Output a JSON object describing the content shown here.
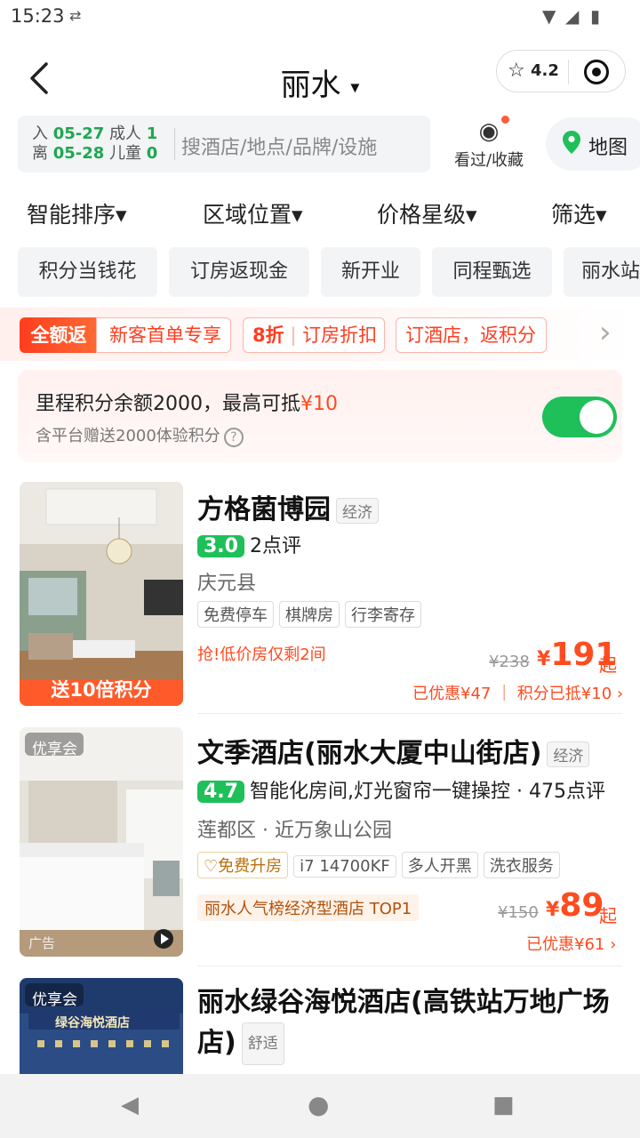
{
  "status": {
    "time": "15:23",
    "icons": "▼◢ ▮"
  },
  "header": {
    "city": "丽水",
    "city_arrow": "▾",
    "rating": "4.2"
  },
  "search": {
    "checkin_label": "入",
    "checkin_date": "05-27",
    "adult_label": "成人",
    "adults": "1",
    "checkout_label": "离",
    "checkout_date": "05-28",
    "child_label": "儿童",
    "children": "0",
    "placeholder": "搜酒店/地点/品牌/设施"
  },
  "favorites": {
    "label": "看过/收藏"
  },
  "map": {
    "label": "地图"
  },
  "sort": [
    "智能排序▾",
    "区域位置▾",
    "价格星级▾",
    "筛选▾"
  ],
  "quick_tags": [
    "积分当钱花",
    "订房返现金",
    "新开业",
    "同程甄选",
    "丽水站"
  ],
  "promo": {
    "full_label": "全额返",
    "item1": "新客首单专享",
    "discount": "8折",
    "item2": "订房折扣",
    "item3": "订酒店，返积分",
    "arrow": "›"
  },
  "points_card": {
    "line1_prefix": "里程积分余额2000，最高可抵",
    "line1_amount": "¥10",
    "line2": "含平台赠送2000体验积分",
    "help": "?"
  },
  "hotels": [
    {
      "name": "方格菌博园",
      "level": "经济",
      "score": "3.0",
      "reviews": "2点评",
      "area": "庆元县",
      "tags": [
        "免费停车",
        "棋牌房",
        "行李寄存"
      ],
      "urgent": "抢!低价房仅剩2间",
      "orig_price": "¥238",
      "price_symbol": "¥",
      "price": "191",
      "qi": "起",
      "discount": "已优惠¥47 ｜ 积分已抵¥10 ›",
      "banner": "送10倍积分"
    },
    {
      "name": "文季酒店(丽水大厦中山街店)",
      "level": "经济",
      "score": "4.7",
      "reviews": "智能化房间,灯光窗帘一键操控 · 475点评",
      "area": "莲都区 · 近万象山公园",
      "tags": [
        "免费升房",
        "i7 14700KF",
        "多人开黑",
        "洗衣服务"
      ],
      "rank": "丽水人气榜经济型酒店 TOP1",
      "orig_price": "¥150",
      "price_symbol": "¥",
      "price": "89",
      "qi": "起",
      "discount": "已优惠¥61 ›",
      "badge": "优享会",
      "ad": "广告"
    },
    {
      "name_line1": "丽水绿谷海悦酒店(高铁站万地广场",
      "name_line2": "店)",
      "level": "舒适",
      "badge": "优享会",
      "sign": "绿谷海悦酒店"
    }
  ],
  "sysnav": {
    "back": "◀",
    "home": "●",
    "recent": "■"
  }
}
